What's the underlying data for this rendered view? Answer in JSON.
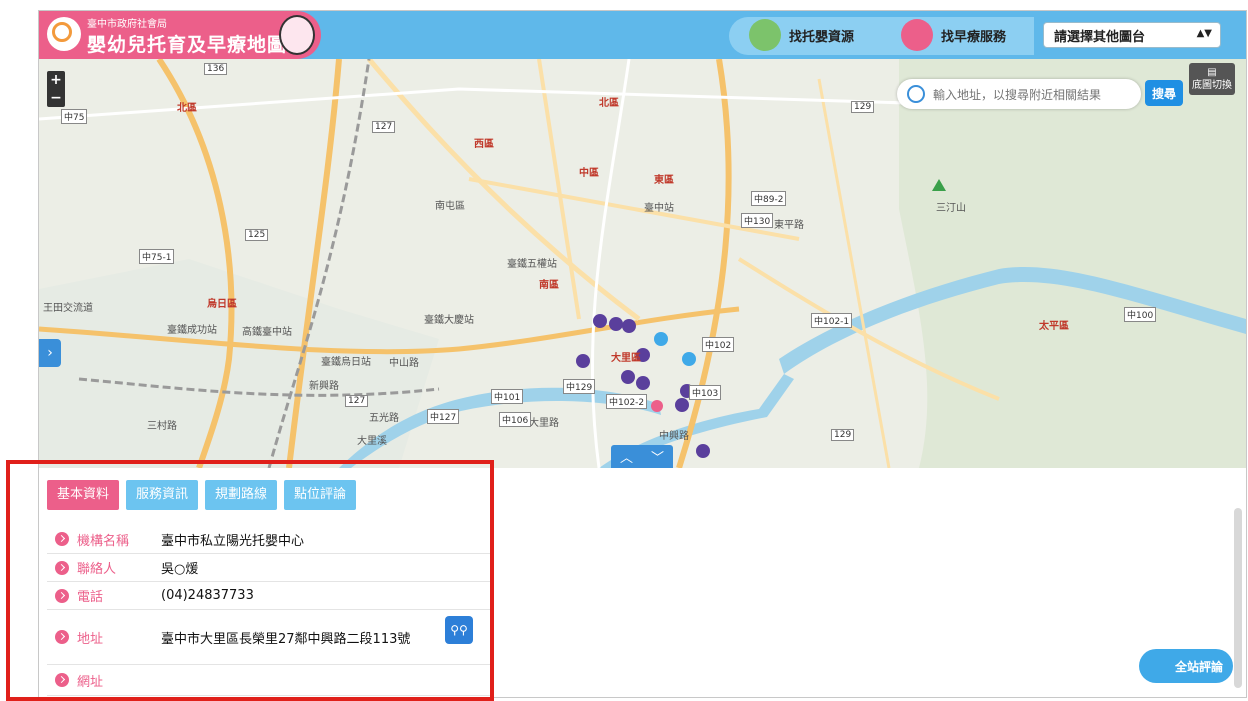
{
  "header": {
    "org": "臺中市政府社會局",
    "title": "嬰幼兒托育及早療地圖",
    "nav": [
      {
        "label": "找托嬰資源",
        "icon": "daycare-house-icon",
        "color": "#7cc36b"
      },
      {
        "label": "找早療服務",
        "icon": "therapist-icon",
        "color": "#ec5f8a"
      }
    ],
    "select": {
      "value": "請選擇其他圖台"
    }
  },
  "map": {
    "search_placeholder": "輸入地址，以搜尋附近相關結果",
    "search_button": "搜尋",
    "base_toggle": "底圖切換",
    "labels": {
      "l1": "北區",
      "l2": "南屯區",
      "l3": "西區",
      "l4": "中區",
      "l5": "東區",
      "l6": "南區",
      "l7": "烏日區",
      "l8": "大里區",
      "l9": "太平區",
      "l10": "三汀山",
      "l11": "臺中站",
      "l12": "臺鐵五權站",
      "l13": "臺鐵大慶站",
      "l14": "臺鐵成功站",
      "l15": "高鐵臺中站",
      "l16": "臺鐵烏日站",
      "l17": "大里溪",
      "l18": "中山路",
      "l19": "新興路",
      "l20": "三村路",
      "l21": "王田交流道",
      "l22": "五光路",
      "l23": "大里路",
      "l24": "中興路",
      "l25": "東平路",
      "r1": "136",
      "r2": "127",
      "r3": "125",
      "r4": "129",
      "r5": "中75-1",
      "r6": "中89-2",
      "r7": "中130",
      "r8": "中102-1",
      "r9": "中102",
      "r10": "中129",
      "r11": "中101",
      "r12": "中106",
      "r13": "中102-2",
      "r14": "中103",
      "r15": "中100",
      "r16": "127",
      "r17": "中127",
      "r18": "129",
      "r19": "中75"
    }
  },
  "panel": {
    "tabs": [
      "基本資料",
      "服務資訊",
      "規劃路線",
      "點位評論"
    ],
    "rows": [
      {
        "label": "機構名稱",
        "value": "臺中市私立陽光托嬰中心"
      },
      {
        "label": "聯絡人",
        "value": "吳○煖"
      },
      {
        "label": "電話",
        "value": "(04)24837733"
      },
      {
        "label": "地址",
        "value": "臺中市大里區長榮里27鄰中興路二段113號"
      },
      {
        "label": "網址",
        "value": ""
      }
    ],
    "review_button": "全站評論"
  },
  "colors": {
    "brand_pink": "#ec5f8a",
    "header_blue": "#5fb8ea",
    "tab_blue": "#6cc4f0",
    "highlight_red": "#e0201a",
    "marker_purple": "#5a3f9c"
  }
}
